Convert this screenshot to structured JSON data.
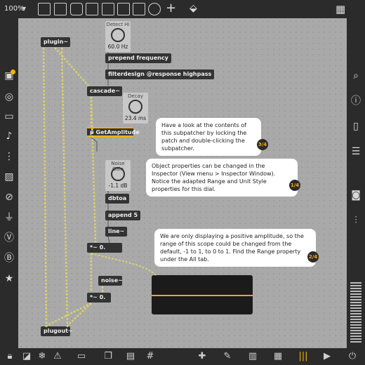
{
  "toolbar": {
    "zoom": "100%",
    "icons": [
      "new-object-icon",
      "message-icon",
      "comment-icon",
      "toggle-icon",
      "button-icon",
      "number-icon",
      "slider-icon",
      "dial-icon",
      "add-icon",
      "paint-icon",
      "grid-icon"
    ]
  },
  "left_sidebar": [
    "object-badge-icon",
    "target-icon",
    "layout-icon",
    "note-icon",
    "presentation-icon",
    "image-icon",
    "link-icon",
    "plug-icon",
    "v-icon",
    "b-icon",
    "star-icon"
  ],
  "right_sidebar": [
    "search-icon",
    "info-icon",
    "book-icon",
    "list-icon",
    "camera-icon",
    "sliders-icon",
    "meter-icon"
  ],
  "objects": {
    "plugin": "plugin~",
    "prepend": "prepend frequency",
    "filterdesign": "filterdesign @response highpass",
    "cascade": "cascade~",
    "getamplitude": "p GetAmplitude",
    "dbtoa": "dbtoa",
    "append": "append 5",
    "line": "line~",
    "mult1": "*~ 0.",
    "noise": "noise~",
    "mult2": "*~ 0.",
    "plugout": "plugout~"
  },
  "dials": {
    "detect": {
      "label": "Detect Hi",
      "value": "60.0 Hz"
    },
    "decay": {
      "label": "Decay",
      "value": "23.4 ms"
    },
    "noise_gain": {
      "label": "Noise Gain",
      "value": "-1.1 dB"
    }
  },
  "bubbles": {
    "b1": {
      "text": "Have a look at the contents of this subpatcher by locking the patch and double-clicking the subpatcher.",
      "step": "3/4"
    },
    "b2": {
      "text": "Object properties can be changed in the Inspector (View menu > Inspector Window). Notice the adapted Range and Unit Style properties for this dial.",
      "step": "1/4"
    },
    "b3": {
      "text": "We are only displaying a positive amplitude, so the range of this scope could be changed from the default, -1 to 1, to 0 to 1. Find the Range property under the All tab.",
      "step": "2/4"
    }
  },
  "colors": {
    "canvas": "#a9a9a9",
    "chrome": "#2b2b2b",
    "accent": "#f5b400",
    "scope_trace": "#f0a030"
  }
}
